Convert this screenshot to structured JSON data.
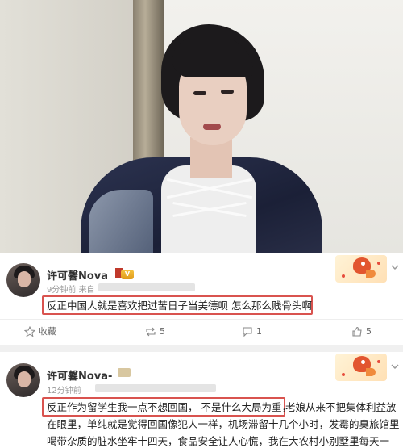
{
  "post1": {
    "username": "许可馨Nova",
    "vip_label": "V",
    "time": "9分钟前",
    "source_prefix": "来自",
    "content_highlighted": "反正中国人就是喜欢把过苦日子当美德呗 怎么那么贱骨头啊",
    "actions": {
      "collect": "收藏",
      "repost": "5",
      "comment": "1",
      "like": "5"
    }
  },
  "post2": {
    "username": "许可馨Nova-",
    "time": "12分钟前",
    "content_highlighted": "反正作为留学生我一点不想回国， 不是什么大局为重，",
    "content_rest_line1": "老娘从来不把集体利益放",
    "content_line2": "在眼里，单纯就是觉得回国像犯人一样，机场滞留十几个小时，发霉的臭旅馆里",
    "content_line3": "喝带杂质的脏水坐牢十四天，食品安全让人心慌，我在大农村小别墅里每天一"
  },
  "colors": {
    "highlight": "#d9534f",
    "text": "#222222",
    "meta": "#999999"
  },
  "icons": [
    "star-icon",
    "repost-icon",
    "comment-icon",
    "like-icon",
    "chevron-down-icon",
    "lucky-fish-decoration-icon"
  ]
}
